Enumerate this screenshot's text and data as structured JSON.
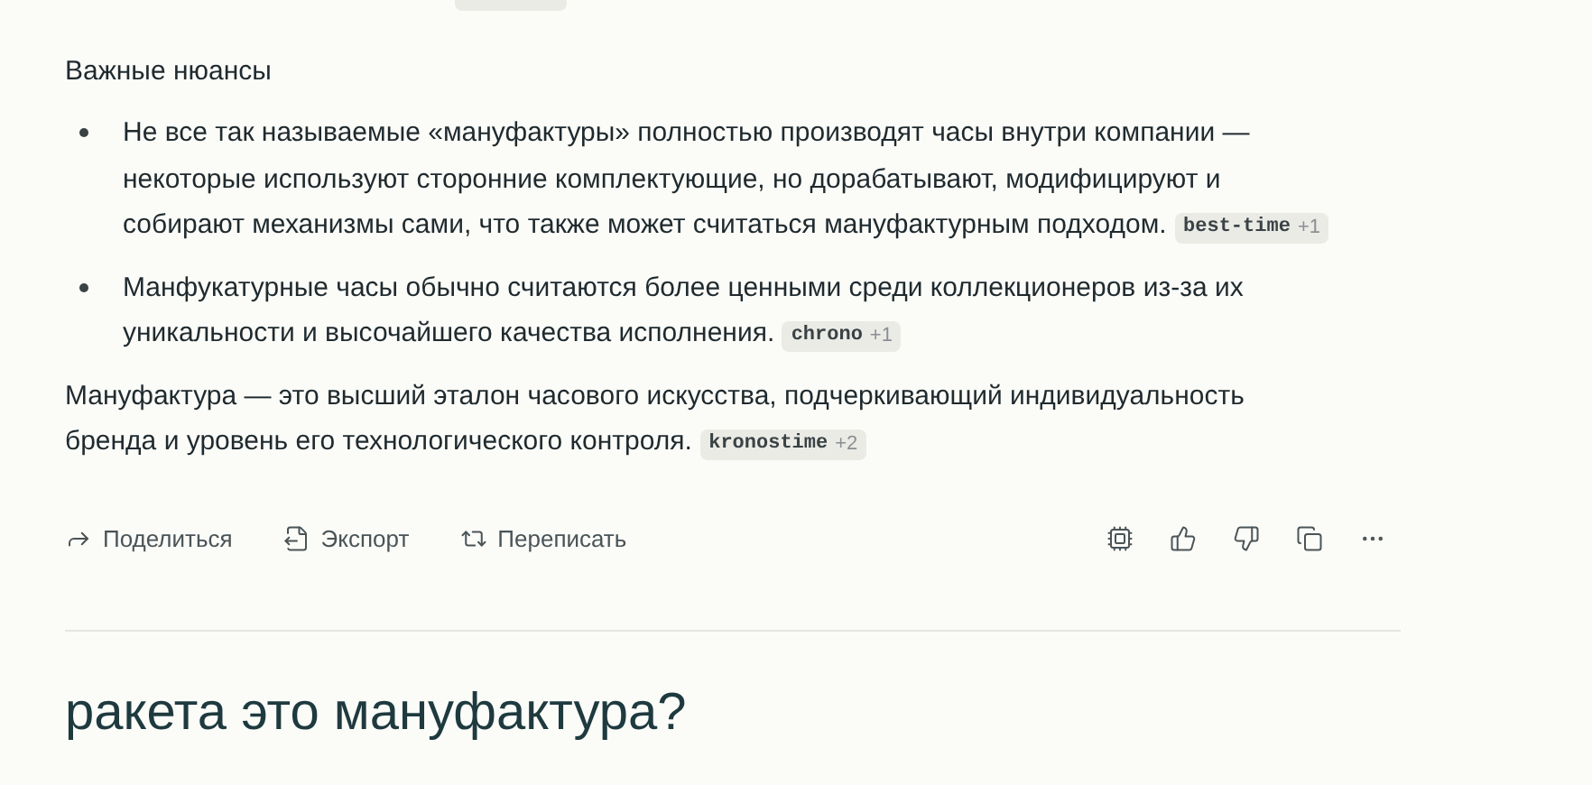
{
  "section_title": "Важные нюансы",
  "bullets": [
    {
      "text": "Не все так называемые «мануфактуры» полностью производят часы внутри компании — некоторые используют сторонние комплектующие, но дорабатывают, модифицируют и собирают механизмы сами, что также может считаться мануфактурным подходом.",
      "source": "best-time",
      "source_count": "+1"
    },
    {
      "text": "Манфукатурные часы обычно считаются более ценными среди коллекционеров из-за их уникальности и высочайшего качества исполнения.",
      "source": "chrono",
      "source_count": "+1"
    }
  ],
  "conclusion": {
    "text": "Мануфактура — это высший эталон часового искусства, подчеркивающий индивидуальность бренда и уровень его технологического контроля.",
    "source": "kronostime",
    "source_count": "+2"
  },
  "actions": [
    {
      "kind": "share",
      "label": "Поделиться"
    },
    {
      "kind": "export",
      "label": "Экспорт"
    },
    {
      "kind": "rewrite",
      "label": "Переписать"
    }
  ],
  "icon_actions": [
    {
      "kind": "chip"
    },
    {
      "kind": "like"
    },
    {
      "kind": "dislike"
    },
    {
      "kind": "copy"
    },
    {
      "kind": "more"
    }
  ],
  "next_question": "ракета это мануфактура?"
}
